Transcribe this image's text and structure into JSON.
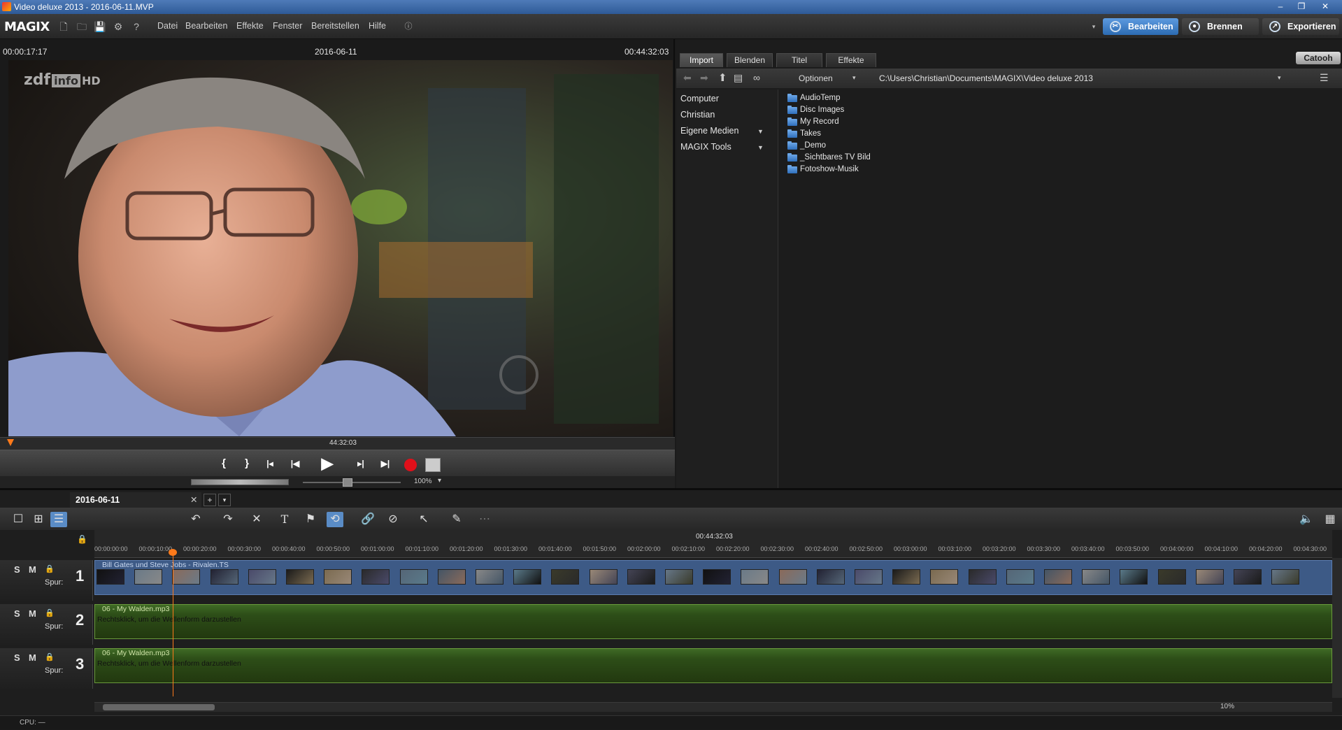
{
  "window": {
    "title": "Video deluxe 2013 - 2016-06-11.MVP",
    "controls": [
      "–",
      "❐",
      "✕"
    ]
  },
  "app": {
    "logo": "MAGIX"
  },
  "menu": [
    "Datei",
    "Bearbeiten",
    "Effekte",
    "Fenster",
    "Bereitstellen",
    "Hilfe"
  ],
  "modes": {
    "edit": "Bearbeiten",
    "burn": "Brennen",
    "export": "Exportieren"
  },
  "preview": {
    "timecode_left": "00:00:17:17",
    "date": "2016-06-11",
    "timecode_right": "00:44:32:03",
    "channel_logo": "zdf",
    "channel_logo_box": "info",
    "channel_logo_hd": "HD",
    "position_label": "44:32:03",
    "zoom": "100%"
  },
  "media": {
    "tabs": [
      "Import",
      "Blenden",
      "Titel",
      "Effekte"
    ],
    "brand": "Catooh",
    "options_label": "Optionen",
    "path": "C:\\Users\\Christian\\Documents\\MAGIX\\Video deluxe 2013",
    "nav": [
      "Computer",
      "Christian",
      "Eigene Medien",
      "MAGIX Tools"
    ],
    "folders": [
      "AudioTemp",
      "Disc Images",
      "My Record",
      "Takes",
      "_Demo",
      "_Sichtbares TV Bild",
      "Fotoshow-Musik"
    ]
  },
  "arranger": {
    "project_tab": "2016-06-11",
    "ruler_top": "00:44:32:03",
    "ruler_ticks": [
      "00:00:00:00",
      "00:00:10:00",
      "00:00:20:00",
      "00:00:30:00",
      "00:00:40:00",
      "00:00:50:00",
      "00:01:00:00",
      "00:01:10:00",
      "00:01:20:00",
      "00:01:30:00",
      "00:01:40:00",
      "00:01:50:00",
      "00:02:00:00",
      "00:02:10:00",
      "00:02:20:00",
      "00:02:30:00",
      "00:02:40:00",
      "00:02:50:00",
      "00:03:00:00",
      "00:03:10:00",
      "00:03:20:00",
      "00:03:30:00",
      "00:03:40:00",
      "00:03:50:00",
      "00:04:00:00",
      "00:04:10:00",
      "00:04:20:00",
      "00:04:30:00"
    ],
    "tracks": [
      {
        "num": "1",
        "solo": "S",
        "mute": "M",
        "label": "Spur:",
        "clip": "Bill Gates und Steve Jobs - Rivalen.TS",
        "hint": ""
      },
      {
        "num": "2",
        "solo": "S",
        "mute": "M",
        "label": "Spur:",
        "clip": "06 - My Walden.mp3",
        "hint": "Rechtsklick, um die Wellenform darzustellen"
      },
      {
        "num": "3",
        "solo": "S",
        "mute": "M",
        "label": "Spur:",
        "clip": "06 - My Walden.mp3",
        "hint": "Rechtsklick, um die Wellenform darzustellen"
      }
    ],
    "zoom": "10%",
    "cpu": "CPU: —"
  },
  "colors": {
    "accent": "#ff7a1a",
    "edit_mode": "#3d7fc4",
    "record": "#e0101a",
    "audio_clip": "#2d4e18",
    "video_clip": "#3d5a86"
  }
}
